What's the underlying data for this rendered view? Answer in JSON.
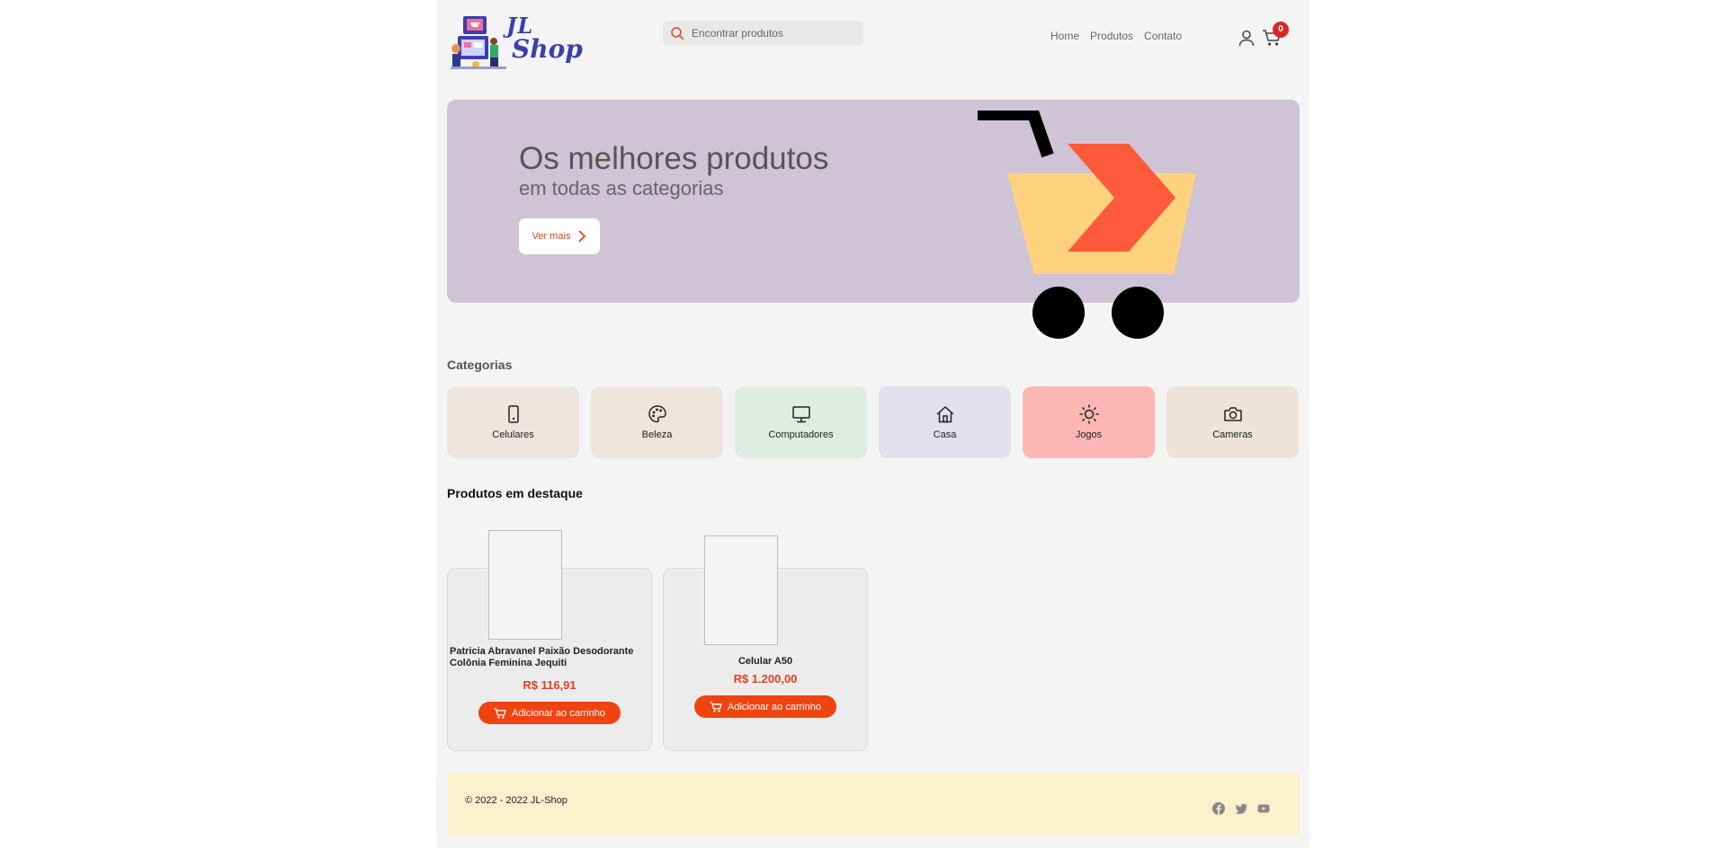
{
  "header": {
    "logo_text_1": "JL",
    "logo_text_2": "Shop",
    "search_placeholder": "Encontrar produtos",
    "nav": [
      "Home",
      "Produtos",
      "Contato"
    ],
    "cart_count": "0"
  },
  "hero": {
    "title": "Os melhores produtos",
    "subtitle": "em todas as categorias",
    "button_label": "Ver mais"
  },
  "categories": {
    "title": "Categorias",
    "items": [
      {
        "label": "Celulares",
        "icon": "phone-icon",
        "color": "#ede3df"
      },
      {
        "label": "Beleza",
        "icon": "palette-icon",
        "color": "#ede4db"
      },
      {
        "label": "Computadores",
        "icon": "monitor-icon",
        "color": "#deece3"
      },
      {
        "label": "Casa",
        "icon": "house-icon",
        "color": "#e3dfec"
      },
      {
        "label": "Jogos",
        "icon": "sun-icon",
        "color": "#fdb7b5"
      },
      {
        "label": "Cameras",
        "icon": "camera-icon",
        "color": "#ede3d8"
      }
    ]
  },
  "featured": {
    "title": "Produtos em destaque",
    "products": [
      {
        "name": "Patricia Abravanel Paixão Desodorante Colônia Feminina Jequiti",
        "price": "R$ 116,91",
        "button": "Adicionar ao carrinho"
      },
      {
        "name": "Celular A50",
        "price": "R$ 1.200,00",
        "button": "Adicionar ao carrinho"
      }
    ]
  },
  "footer": {
    "copyright": "© 2022 - 2022 JL-Shop",
    "socials": [
      "facebook-icon",
      "twitter-icon",
      "youtube-icon"
    ]
  },
  "colors": {
    "accent": "#f04410",
    "hero_bg": "#cfc3d6",
    "footer_bg": "#fdf0cc",
    "badge": "#d62828"
  }
}
